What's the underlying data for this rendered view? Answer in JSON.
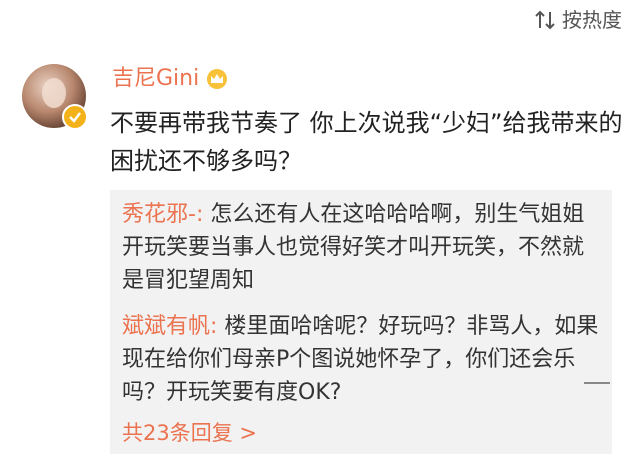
{
  "sort": {
    "label": "按热度",
    "icon": "sort-icon"
  },
  "comment": {
    "username": "吉尼Gini",
    "badge_icon": "crown-icon",
    "verified_icon": "verified-badge-icon",
    "text": "不要再带我节奏了 你上次说我“少妇”给我带来的困扰还不够多吗？"
  },
  "replies": [
    {
      "author": "秀花邪-:",
      "text": " 怎么还有人在这哈哈哈啊，别生气姐姐 开玩笑要当事人也觉得好笑才叫开玩笑，不然就是冒犯望周知"
    },
    {
      "author": "斌斌有帆:",
      "text": " 楼里面哈啥呢？好玩吗？非骂人，如果现在给你们母亲P个图说她怀孕了，你们还会乐吗？开玩笑要有度OK?"
    }
  ],
  "more_replies": "共23条回复 >",
  "colors": {
    "accent": "#eb7350",
    "text": "#222222",
    "reply_bg": "#f2f2f2",
    "badge": "#f3b21a"
  }
}
